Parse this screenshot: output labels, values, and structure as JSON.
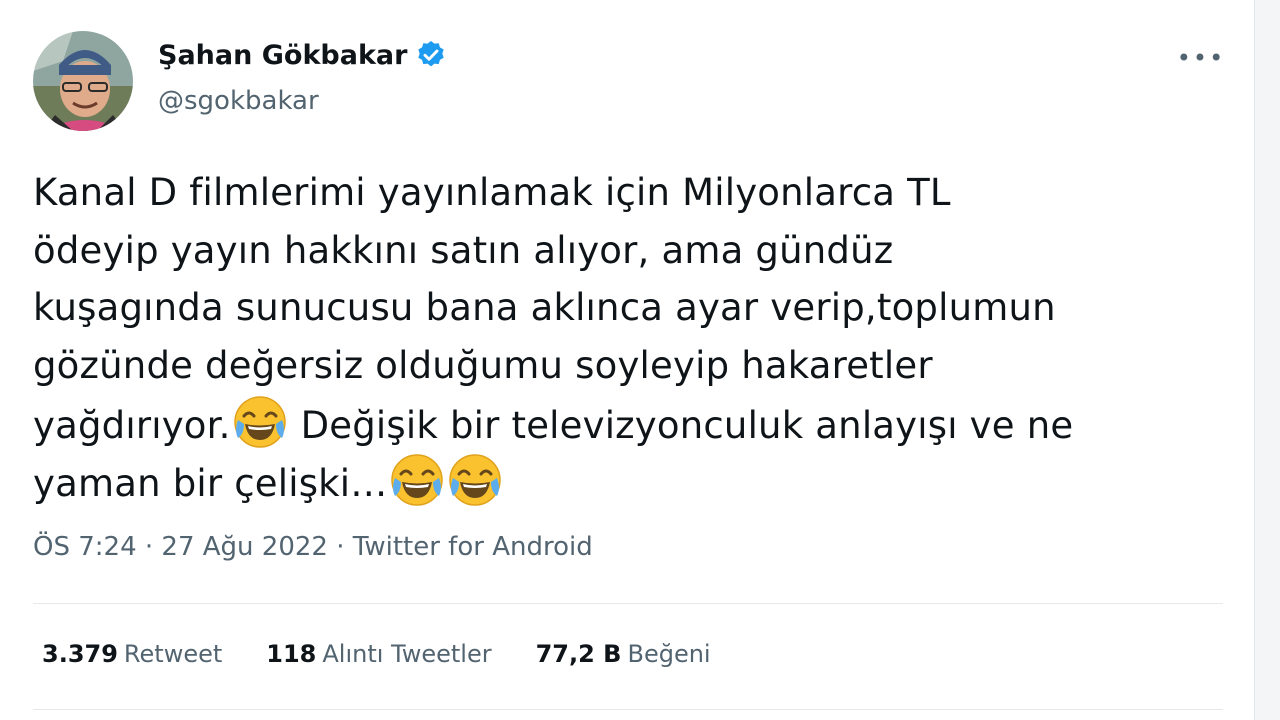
{
  "author": {
    "name": "Şahan Gökbakar",
    "handle": "@sgokbakar",
    "verified": true,
    "avatar_icon": "profile-photo"
  },
  "more_icon_glyph": "•••",
  "tweet": {
    "lines": [
      [
        "Kanal D filmlerimi yayınlamak için Milyonlarca TL"
      ],
      [
        "ödeyip yayın hakkını satın alıyor, ama gündüz"
      ],
      [
        "kuşagında sunucusu bana aklınca ayar verip,toplumun"
      ],
      [
        "gözünde değersiz olduğumu soyleyip hakaretler"
      ],
      [
        "yağdırıyor.",
        "😂",
        " Değişik bir televizyonculuk anlayışı ve ne"
      ],
      [
        "yaman bir çelişki…",
        "😂",
        "😂"
      ]
    ]
  },
  "meta": {
    "time": "ÖS 7:24",
    "separator1": " · ",
    "date": "27 Ağu 2022",
    "separator2": " · ",
    "source": "Twitter for Android"
  },
  "stats": [
    {
      "count": "3.379",
      "label": "Retweet"
    },
    {
      "count": "118",
      "label": "Alıntı Tweetler"
    },
    {
      "count": "77,2 B",
      "label": "Beğeni"
    }
  ],
  "colors": {
    "verified_blue": "#1d9bf0",
    "muted_text": "#536471",
    "primary_text": "#0f1419"
  }
}
